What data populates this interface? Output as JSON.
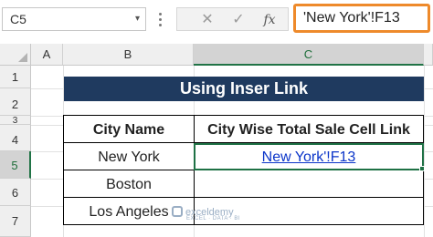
{
  "formula_bar": {
    "name_box": "C5",
    "name_box_caret": "▾",
    "cancel_icon": "✕",
    "enter_icon": "✓",
    "fx_label": "fx",
    "formula": "'New York'!F13"
  },
  "columns": [
    "A",
    "B",
    "C"
  ],
  "rows": [
    "1",
    "2",
    "3",
    "4",
    "5",
    "6",
    "7"
  ],
  "selected": {
    "column": "C",
    "row": "5"
  },
  "title": "Using Inser Link",
  "table": {
    "headers": [
      "City Name",
      "City Wise Total Sale Cell Link"
    ],
    "rows": [
      {
        "city": "New York",
        "link": "New York'!F13"
      },
      {
        "city": "Boston",
        "link": ""
      },
      {
        "city": "Los Angeles",
        "link": ""
      }
    ]
  },
  "watermark": {
    "brand": "exceldemy",
    "tagline": "EXCEL · DATA · BI"
  },
  "colors": {
    "banner_bg": "#1f3a5f",
    "selection": "#1e7145",
    "formula_highlight": "#ee8a2b",
    "link": "#0b35c9"
  }
}
